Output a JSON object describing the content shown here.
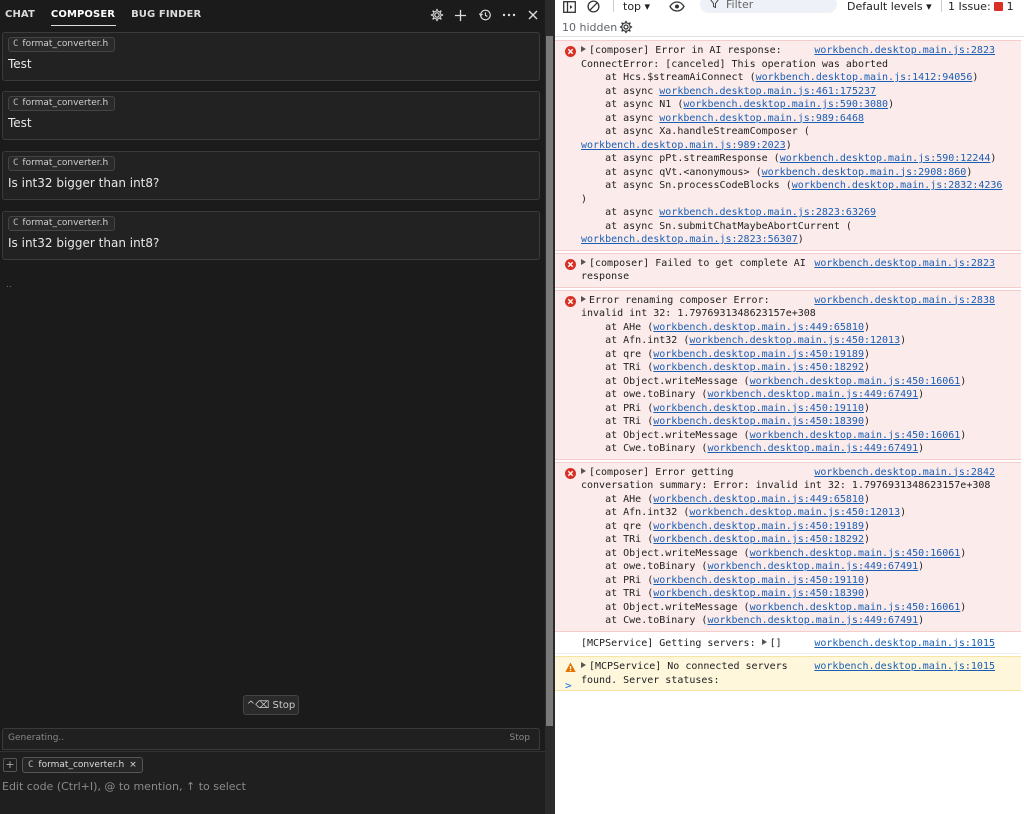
{
  "left": {
    "tabs": [
      {
        "label": "CHAT"
      },
      {
        "label": "COMPOSER"
      },
      {
        "label": "BUG FINDER"
      }
    ],
    "messages": [
      {
        "chip": "format_converter.h",
        "text": "Test"
      },
      {
        "chip": "format_converter.h",
        "text": "Test"
      },
      {
        "chip": "format_converter.h",
        "text": "Is int32 bigger than int8?"
      },
      {
        "chip": "format_converter.h",
        "text": "Is int32 bigger than int8?"
      }
    ],
    "chip_lang": "C",
    "dots": "..",
    "stop_button": "^⌫ Stop",
    "generating": "Generating..",
    "generating_stop": "Stop",
    "input_chip": "format_converter.h",
    "input_chip_close": "×",
    "input_placeholder": "Edit code (Ctrl+I), @ to mention, ↑ to select",
    "plus": "+"
  },
  "devtools": {
    "context": "top",
    "filter_placeholder": "Filter",
    "levels": "Default levels",
    "issues_label": "1 Issue:",
    "issues_count": "1",
    "hidden_count": "10 hidden",
    "prompt": ">",
    "entries": [
      {
        "level": "error",
        "source": "workbench.desktop.main.js:2823",
        "lines": [
          [
            {
              "t": "caret"
            },
            {
              "t": "[composer] Error in AI response:"
            }
          ],
          [
            {
              "t": "ConnectError: [canceled] This operation was aborted"
            }
          ],
          [
            {
              "t": "    at Hcs.$streamAiConnect ("
            },
            {
              "l": "workbench.desktop.main.js:1412:94056"
            },
            {
              "t": ")"
            }
          ],
          [
            {
              "t": "    at async "
            },
            {
              "l": "workbench.desktop.main.js:461:175237"
            }
          ],
          [
            {
              "t": "    at async N1 ("
            },
            {
              "l": "workbench.desktop.main.js:590:3080"
            },
            {
              "t": ")"
            }
          ],
          [
            {
              "t": "    at async "
            },
            {
              "l": "workbench.desktop.main.js:989:6468"
            }
          ],
          [
            {
              "t": "    at async Xa.handleStreamComposer ("
            }
          ],
          [
            {
              "l": "workbench.desktop.main.js:989:2023"
            },
            {
              "t": ")"
            }
          ],
          [
            {
              "t": "    at async pPt.streamResponse ("
            },
            {
              "l": "workbench.desktop.main.js:590:12244"
            },
            {
              "t": ")"
            }
          ],
          [
            {
              "t": "    at async qVt.<anonymous> ("
            },
            {
              "l": "workbench.desktop.main.js:2908:860"
            },
            {
              "t": ")"
            }
          ],
          [
            {
              "t": "    at async Sn.processCodeBlocks ("
            },
            {
              "l": "workbench.desktop.main.js:2832:4236"
            }
          ],
          [
            {
              "t": ")"
            }
          ],
          [
            {
              "t": "    at async "
            },
            {
              "l": "workbench.desktop.main.js:2823:63269"
            }
          ],
          [
            {
              "t": "    at async Sn.submitChatMaybeAbortCurrent ("
            }
          ],
          [
            {
              "l": "workbench.desktop.main.js:2823:56307"
            },
            {
              "t": ")"
            }
          ]
        ]
      },
      {
        "level": "error",
        "source": "workbench.desktop.main.js:2823",
        "lines": [
          [
            {
              "t": "caret"
            },
            {
              "t": "[composer] Failed to get complete AI"
            }
          ],
          [
            {
              "t": "response"
            }
          ]
        ]
      },
      {
        "level": "error",
        "source": "workbench.desktop.main.js:2838",
        "lines": [
          [
            {
              "t": "caret"
            },
            {
              "t": "Error renaming composer Error:"
            }
          ],
          [
            {
              "t": "invalid int 32: 1.7976931348623157e+308"
            }
          ],
          [
            {
              "t": "    at AHe ("
            },
            {
              "l": "workbench.desktop.main.js:449:65810"
            },
            {
              "t": ")"
            }
          ],
          [
            {
              "t": "    at Afn.int32 ("
            },
            {
              "l": "workbench.desktop.main.js:450:12013"
            },
            {
              "t": ")"
            }
          ],
          [
            {
              "t": "    at qre ("
            },
            {
              "l": "workbench.desktop.main.js:450:19189"
            },
            {
              "t": ")"
            }
          ],
          [
            {
              "t": "    at TRi ("
            },
            {
              "l": "workbench.desktop.main.js:450:18292"
            },
            {
              "t": ")"
            }
          ],
          [
            {
              "t": "    at Object.writeMessage ("
            },
            {
              "l": "workbench.desktop.main.js:450:16061"
            },
            {
              "t": ")"
            }
          ],
          [
            {
              "t": "    at owe.toBinary ("
            },
            {
              "l": "workbench.desktop.main.js:449:67491"
            },
            {
              "t": ")"
            }
          ],
          [
            {
              "t": "    at PRi ("
            },
            {
              "l": "workbench.desktop.main.js:450:19110"
            },
            {
              "t": ")"
            }
          ],
          [
            {
              "t": "    at TRi ("
            },
            {
              "l": "workbench.desktop.main.js:450:18390"
            },
            {
              "t": ")"
            }
          ],
          [
            {
              "t": "    at Object.writeMessage ("
            },
            {
              "l": "workbench.desktop.main.js:450:16061"
            },
            {
              "t": ")"
            }
          ],
          [
            {
              "t": "    at Cwe.toBinary ("
            },
            {
              "l": "workbench.desktop.main.js:449:67491"
            },
            {
              "t": ")"
            }
          ]
        ]
      },
      {
        "level": "error",
        "source": "workbench.desktop.main.js:2842",
        "lines": [
          [
            {
              "t": "caret"
            },
            {
              "t": "[composer] Error getting"
            }
          ],
          [
            {
              "t": "conversation summary: Error: invalid int 32: 1.7976931348623157e+308"
            }
          ],
          [
            {
              "t": "    at AHe ("
            },
            {
              "l": "workbench.desktop.main.js:449:65810"
            },
            {
              "t": ")"
            }
          ],
          [
            {
              "t": "    at Afn.int32 ("
            },
            {
              "l": "workbench.desktop.main.js:450:12013"
            },
            {
              "t": ")"
            }
          ],
          [
            {
              "t": "    at qre ("
            },
            {
              "l": "workbench.desktop.main.js:450:19189"
            },
            {
              "t": ")"
            }
          ],
          [
            {
              "t": "    at TRi ("
            },
            {
              "l": "workbench.desktop.main.js:450:18292"
            },
            {
              "t": ")"
            }
          ],
          [
            {
              "t": "    at Object.writeMessage ("
            },
            {
              "l": "workbench.desktop.main.js:450:16061"
            },
            {
              "t": ")"
            }
          ],
          [
            {
              "t": "    at owe.toBinary ("
            },
            {
              "l": "workbench.desktop.main.js:449:67491"
            },
            {
              "t": ")"
            }
          ],
          [
            {
              "t": "    at PRi ("
            },
            {
              "l": "workbench.desktop.main.js:450:19110"
            },
            {
              "t": ")"
            }
          ],
          [
            {
              "t": "    at TRi ("
            },
            {
              "l": "workbench.desktop.main.js:450:18390"
            },
            {
              "t": ")"
            }
          ],
          [
            {
              "t": "    at Object.writeMessage ("
            },
            {
              "l": "workbench.desktop.main.js:450:16061"
            },
            {
              "t": ")"
            }
          ],
          [
            {
              "t": "    at Cwe.toBinary ("
            },
            {
              "l": "workbench.desktop.main.js:449:67491"
            },
            {
              "t": ")"
            }
          ]
        ]
      },
      {
        "level": "info",
        "source": "workbench.desktop.main.js:1015",
        "lines": [
          [
            {
              "t": "[MCPService] Getting servers: "
            },
            {
              "t": "caret"
            },
            {
              "t": "[]"
            }
          ]
        ]
      },
      {
        "level": "warn",
        "source": "workbench.desktop.main.js:1015",
        "lines": [
          [
            {
              "t": "caret"
            },
            {
              "t": "[MCPService] No connected servers"
            }
          ],
          [
            {
              "t": "found. Server statuses:"
            }
          ]
        ]
      }
    ]
  },
  "colors": {
    "left_bg": "#1b1b1b",
    "error_bg": "#fcebeb",
    "warn_bg": "#fef7dc",
    "link": "#1a5fb4",
    "error_icon": "#d93025",
    "warn_icon": "#e37400"
  },
  "icons": [
    "gear-icon",
    "plus-icon",
    "history-icon",
    "more-icon",
    "close-icon",
    "sidebar-toggle-icon",
    "clear-icon",
    "eye-icon",
    "filter-icon",
    "error-icon",
    "warning-icon"
  ]
}
